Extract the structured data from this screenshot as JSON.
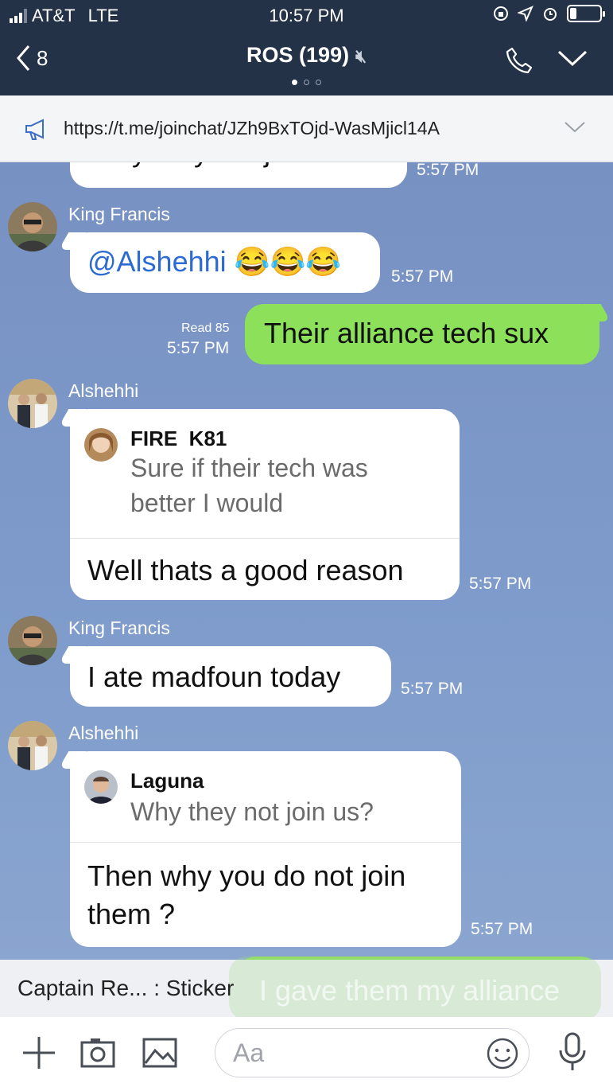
{
  "status_bar": {
    "carrier": "AT&T",
    "network": "LTE",
    "time": "10:57 PM"
  },
  "header": {
    "back_count": "8",
    "title": "ROS (199)"
  },
  "pinned": {
    "url": "https://t.me/joinchat/JZh9BxTOjd-WasMjicl14A"
  },
  "messages": [
    {
      "type": "partial",
      "text": "Why they not join us?",
      "time": "5:57 PM"
    },
    {
      "type": "incoming",
      "sender": "King Francis",
      "text": "@Alshehhi 😂😂😂",
      "time": "5:57 PM"
    },
    {
      "type": "outgoing",
      "text": "Their alliance tech sux",
      "read": "Read 85",
      "time": "5:57 PM"
    },
    {
      "type": "reply",
      "sender": "Alshehhi",
      "quote_name": "FIRE  K81",
      "quote_text_1": "Sure if their tech was",
      "quote_text_2": "better I would",
      "text": "Well thats a good reason",
      "time": "5:57 PM"
    },
    {
      "type": "incoming",
      "sender": "King Francis",
      "text": "I ate madfoun today",
      "time": "5:57 PM"
    },
    {
      "type": "reply",
      "sender": "Alshehhi",
      "quote_name": "Laguna",
      "quote_text_1": "Why they not join us?",
      "text_1": "Then why you do not join",
      "text_2": "them ?",
      "time": "5:57 PM"
    }
  ],
  "last_message": {
    "text": "Captain Re... : Sticker",
    "behind_text": "I gave them my alliance"
  },
  "input": {
    "placeholder": "Aa"
  }
}
